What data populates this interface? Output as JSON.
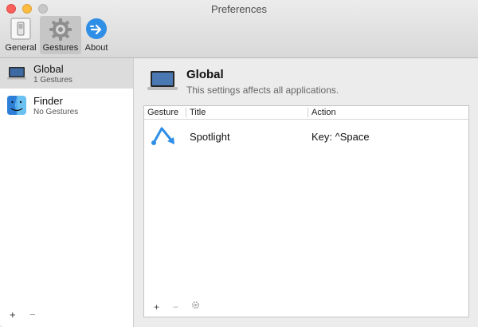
{
  "window": {
    "title": "Preferences"
  },
  "toolbar": {
    "general_label": "General",
    "gestures_label": "Gestures",
    "about_label": "About"
  },
  "sidebar": {
    "items": [
      {
        "name": "Global",
        "subtitle": "1 Gestures",
        "icon": "laptop-icon",
        "selected": true
      },
      {
        "name": "Finder",
        "subtitle": "No Gestures",
        "icon": "finder-icon",
        "selected": false
      }
    ],
    "add_label": "+",
    "remove_label": "−"
  },
  "main": {
    "title": "Global",
    "subtitle": "This settings affects all applications.",
    "table": {
      "columns": [
        "Gesture",
        "Title",
        "Action"
      ],
      "rows": [
        {
          "gesture_icon": "gesture-up-down-icon",
          "title": "Spotlight",
          "action": "Key: ^Space"
        }
      ]
    },
    "add_label": "+",
    "remove_label": "−"
  },
  "colors": {
    "accent": "#2f8ee6",
    "selected_row": "#dcdcdc"
  }
}
